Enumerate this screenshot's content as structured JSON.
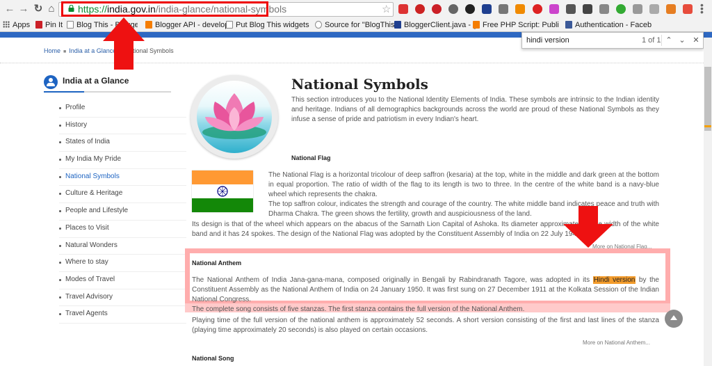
{
  "browser": {
    "url": {
      "scheme": "https://",
      "host": "india.gov.in",
      "path": "/india-glance/national-symbols"
    },
    "bookmarks": [
      "Apps",
      "Pin It",
      "Blog This - Blogger edit",
      "Blogger API - develop",
      "Put Blog This widgets",
      "Source for \"BlogThis",
      "BloggerClient.java - g",
      "Free PHP Script: Publi",
      "Authentication - Faceb"
    ],
    "find": {
      "query": "hindi version",
      "count": "1 of 1"
    },
    "colors": {
      "accent_blue": "#2e68c2",
      "highlight_red": "#e00000",
      "find_match": "#f39c2c"
    }
  },
  "breadcrumb": {
    "home": "Home",
    "parent": "India at a Glance",
    "current": "National Symbols"
  },
  "sidebar": {
    "title": "India at a Glance",
    "items": [
      "Profile",
      "History",
      "States of India",
      "My India My Pride",
      "National Symbols",
      "Culture & Heritage",
      "People and Lifestyle",
      "Places to Visit",
      "Natural Wonders",
      "Where to stay",
      "Modes of Travel",
      "Travel Advisory",
      "Travel Agents"
    ],
    "active_index": 4
  },
  "main": {
    "title": "National Symbols",
    "intro": "This section introduces you to the National Identity Elements of India. These symbols are intrinsic to the Indian identity and heritage. Indians of all demographics backgrounds across the world are proud of these National Symbols as they infuse a sense of pride and patriotism in every Indian's heart.",
    "flag": {
      "heading": "National Flag",
      "para1": "The National Flag is a horizontal tricolour of deep saffron (kesaria) at the top, white in the middle and dark green at the bottom in equal proportion. The ratio of width of the flag to its length is two to three. In the centre of the white band is a navy-blue wheel which represents the chakra.",
      "para2": "The top saffron colour, indicates the strength and courage of the country. The white middle band indicates peace and truth with Dharma Chakra. The green shows the fertility, growth and auspiciousness of the land.",
      "para3": "Its design is that of the wheel which appears on the abacus of the Sarnath Lion Capital of Ashoka. Its diameter approximates to the width of the white band and it has 24 spokes. The design of the National Flag was adopted by the Constituent Assembly of India on 22 July 1947.",
      "more": "More on National Flag..."
    },
    "anthem": {
      "heading": "National Anthem",
      "para1_before": "The National Anthem of India Jana-gana-mana, composed originally in Bengali by Rabindranath Tagore, was adopted in its ",
      "para1_match": "Hindi version",
      "para1_after": " by the Constituent Assembly as the National Anthem of India on 24 January 1950. It was first sung on 27 December 1911 at the Kolkata Session of the Indian National Congress.",
      "para2": "The complete song consists of five stanzas. The first stanza contains the full version of the National Anthem.",
      "para3": "Playing time of the full version of the national anthem is approximately 52 seconds. A short version consisting of the first and last lines of the stanza (playing time approximately 20 seconds) is also played on certain occasions.",
      "more": "More on National Anthem..."
    },
    "song": {
      "heading": "National Song"
    }
  }
}
